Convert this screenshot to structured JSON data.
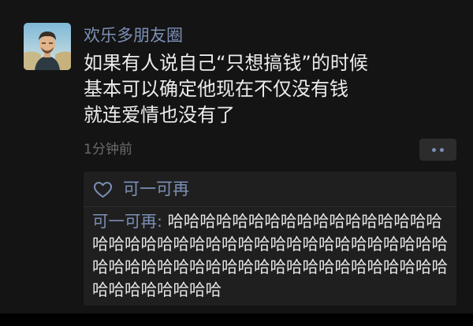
{
  "post": {
    "username": "欢乐多朋友圈",
    "content_lines": [
      "如果有人说自己“只想搞钱”的时候",
      "基本可以确定他现在不仅没有钱",
      "就连爱情也没有了"
    ],
    "time": "1分钟前"
  },
  "likes": {
    "names": "可一可再"
  },
  "comments": [
    {
      "author": "可一可再",
      "separator": ": ",
      "text": "哈哈哈哈哈哈哈哈哈哈哈哈哈哈哈哈哈哈哈哈哈哈哈哈哈哈哈哈哈哈哈哈哈哈哈哈哈哈哈哈哈哈哈哈哈哈哈哈哈哈哈哈哈哈哈哈哈哈哈哈哈哈哈哈哈哈哈哈哈"
    }
  ],
  "icons": {
    "like": "heart-outline-icon",
    "more": "more-dots-icon",
    "avatar": "user-avatar"
  },
  "colors": {
    "background": "#141414",
    "link_blue": "#7b8fb5",
    "text": "#ececec",
    "meta": "#6b6b6b",
    "panel": "#1f1f1f"
  }
}
